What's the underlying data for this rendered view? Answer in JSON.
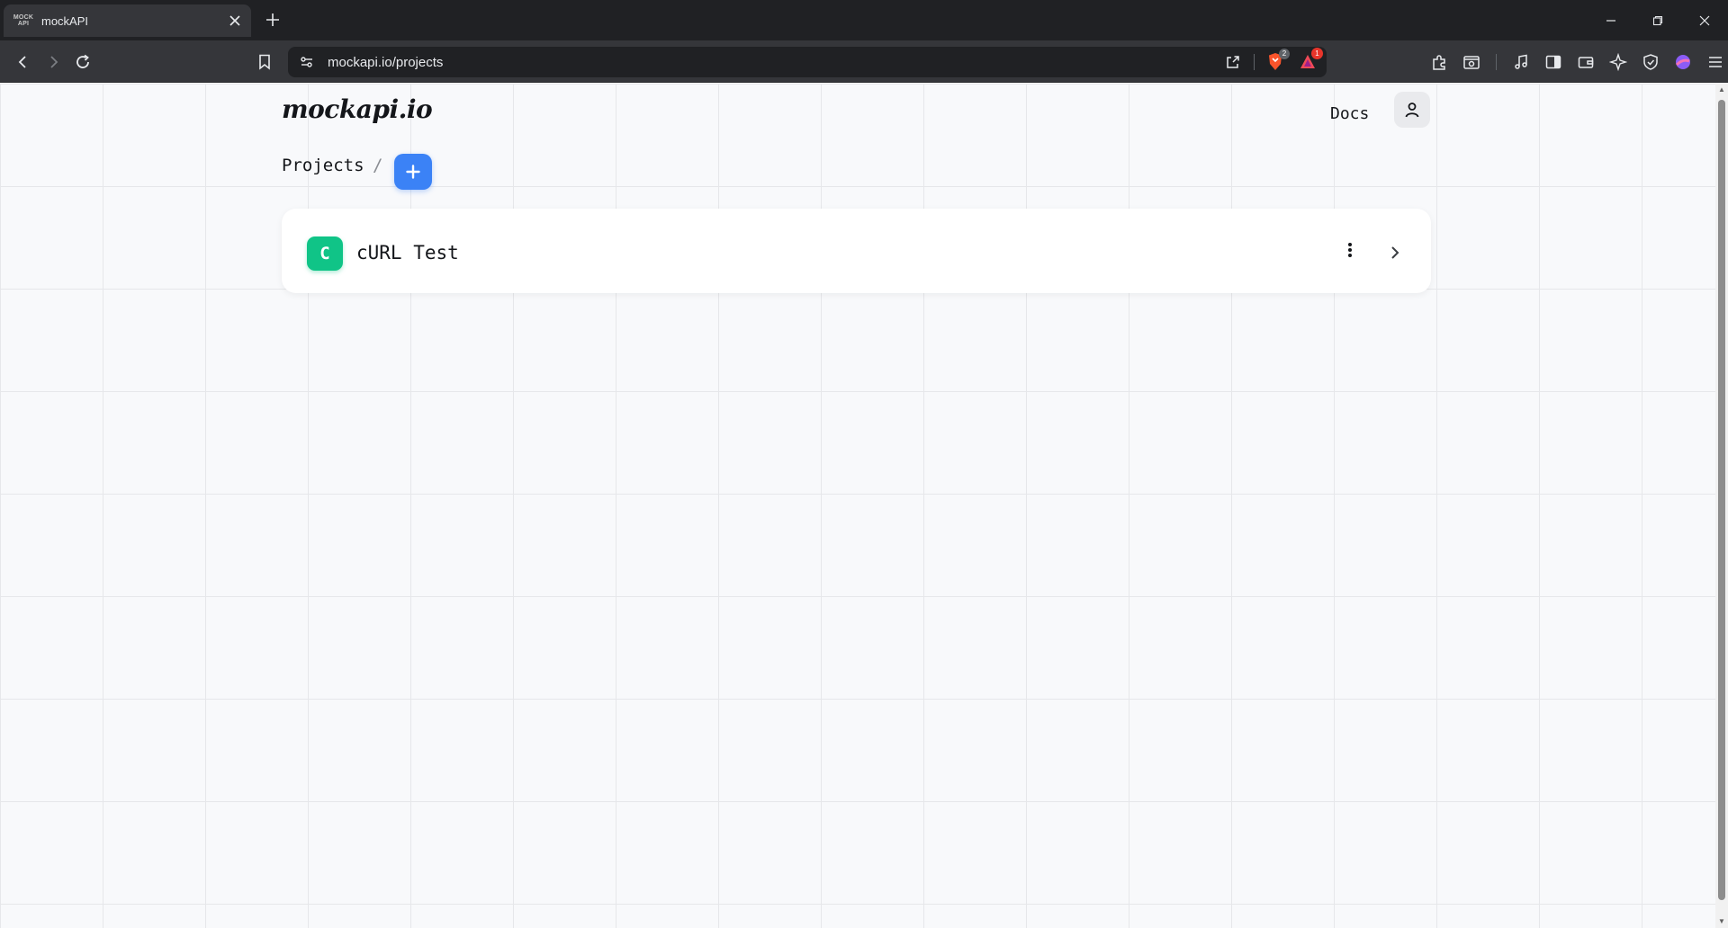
{
  "browser": {
    "tab": {
      "title": "mockAPI",
      "favicon_top": "MOCK",
      "favicon_bottom": "API"
    },
    "url": "mockapi.io/projects",
    "brave_shield_count": "2",
    "rewards_count": "1"
  },
  "site": {
    "logo": "mockapi.io",
    "nav": {
      "docs_label": "Docs"
    }
  },
  "breadcrumb": {
    "projects_label": "Projects",
    "separator": "/"
  },
  "projects": [
    {
      "initial": "C",
      "name": "cURL Test",
      "badge_color": "#10c487"
    }
  ],
  "colors": {
    "accent": "#3b82f6",
    "project_badge": "#10c487"
  },
  "icons": {
    "add": "plus-icon",
    "user": "user-icon",
    "menu": "more-vertical-icon",
    "open": "chevron-right-icon"
  }
}
